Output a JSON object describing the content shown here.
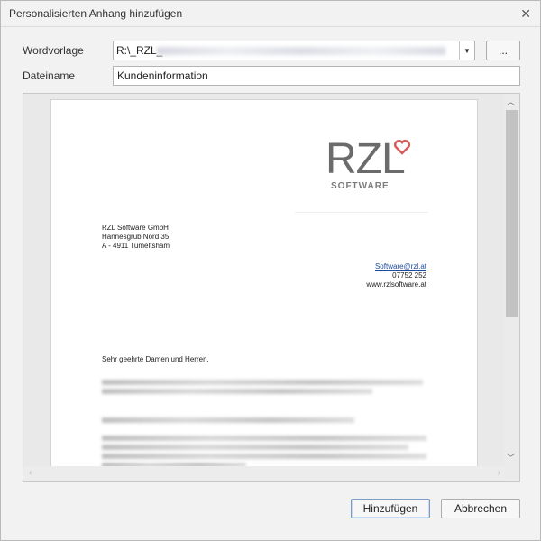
{
  "window": {
    "title": "Personalisierten Anhang hinzufügen",
    "close_glyph": "✕"
  },
  "form": {
    "wordvorlage_label": "Wordvorlage",
    "wordvorlage_value": "R:\\_RZL_",
    "browse_label": "...",
    "dateiname_label": "Dateiname",
    "dateiname_value": "Kundeninformation"
  },
  "preview": {
    "logo_text": "RZL",
    "logo_sub": "SOFTWARE",
    "address": [
      "RZL Software GmbH",
      "Hannesgrub Nord 35",
      "A - 4911 Tumeltsham"
    ],
    "contact_email": "Software@rzl.at",
    "contact_phone": "07752 252",
    "contact_web": "www.rzlsoftware.at",
    "greeting": "Sehr geehrte Damen und Herren,"
  },
  "buttons": {
    "add": "Hinzufügen",
    "cancel": "Abbrechen"
  },
  "colors": {
    "logo_heart": "#d85a5a",
    "logo_text": "#6b6b6b",
    "link": "#1a4a9a"
  }
}
